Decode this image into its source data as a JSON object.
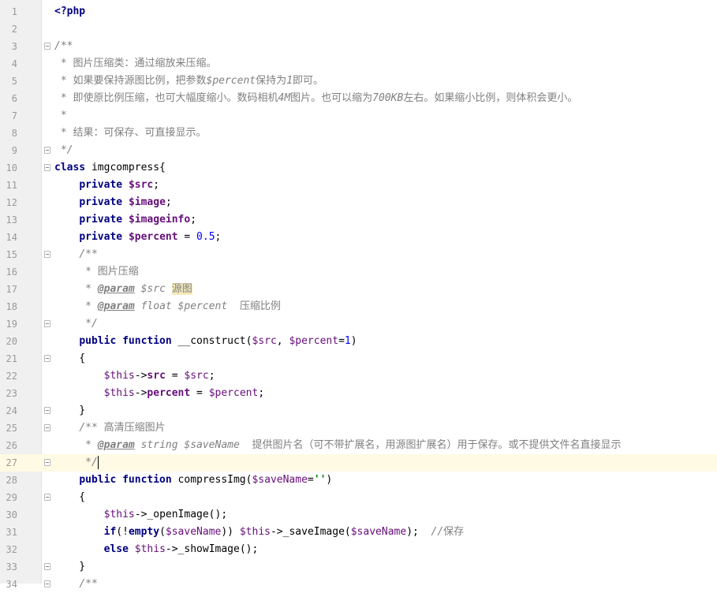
{
  "colors": {
    "keyword": "#000080",
    "variable": "#660e7a",
    "doc_comment": "#808080",
    "string": "#008000",
    "number": "#0000ff",
    "current_line": "#fffae3",
    "highlight": "#f6ebbc"
  },
  "lines": [
    {
      "n": "1",
      "segs": [
        [
          "php-open",
          "<?php"
        ]
      ]
    },
    {
      "n": "2",
      "segs": []
    },
    {
      "n": "3",
      "fold": true,
      "segs": [
        [
          "doc",
          "/**"
        ]
      ]
    },
    {
      "n": "4",
      "segs": [
        [
          "doc",
          " * "
        ],
        [
          "doc-cjk",
          "图片压缩类：通过缩放来压缩。"
        ]
      ]
    },
    {
      "n": "5",
      "segs": [
        [
          "doc",
          " * "
        ],
        [
          "doc-cjk",
          "如果要保持源图比例，把参数"
        ],
        [
          "doc",
          "$percent"
        ],
        [
          "doc-cjk",
          "保持为"
        ],
        [
          "doc",
          "1"
        ],
        [
          "doc-cjk",
          "即可。"
        ]
      ]
    },
    {
      "n": "6",
      "segs": [
        [
          "doc",
          " * "
        ],
        [
          "doc-cjk",
          "即使原比例压缩，也可大幅度缩小。数码相机"
        ],
        [
          "doc",
          "4M"
        ],
        [
          "doc-cjk",
          "图片。也可以缩为"
        ],
        [
          "doc",
          "700KB"
        ],
        [
          "doc-cjk",
          "左右。如果缩小比例，则体积会更小。"
        ]
      ]
    },
    {
      "n": "7",
      "segs": [
        [
          "doc",
          " *"
        ]
      ]
    },
    {
      "n": "8",
      "segs": [
        [
          "doc",
          " * "
        ],
        [
          "doc-cjk",
          "结果：可保存、可直接显示。"
        ]
      ]
    },
    {
      "n": "9",
      "fold": true,
      "segs": [
        [
          "doc",
          " */"
        ]
      ]
    },
    {
      "n": "10",
      "fold": true,
      "segs": [
        [
          "kw",
          "class"
        ],
        [
          "plain",
          " imgcompress{"
        ]
      ]
    },
    {
      "n": "11",
      "segs": [
        [
          "plain",
          "    "
        ],
        [
          "kw",
          "private"
        ],
        [
          "plain",
          " "
        ],
        [
          "prop",
          "$src"
        ],
        [
          "plain",
          ";"
        ]
      ]
    },
    {
      "n": "12",
      "segs": [
        [
          "plain",
          "    "
        ],
        [
          "kw",
          "private"
        ],
        [
          "plain",
          " "
        ],
        [
          "prop",
          "$image"
        ],
        [
          "plain",
          ";"
        ]
      ]
    },
    {
      "n": "13",
      "segs": [
        [
          "plain",
          "    "
        ],
        [
          "kw",
          "private"
        ],
        [
          "plain",
          " "
        ],
        [
          "prop",
          "$imageinfo"
        ],
        [
          "plain",
          ";"
        ]
      ]
    },
    {
      "n": "14",
      "segs": [
        [
          "plain",
          "    "
        ],
        [
          "kw",
          "private"
        ],
        [
          "plain",
          " "
        ],
        [
          "prop",
          "$percent"
        ],
        [
          "plain",
          " = "
        ],
        [
          "num",
          "0.5"
        ],
        [
          "plain",
          ";"
        ]
      ]
    },
    {
      "n": "15",
      "fold": true,
      "segs": [
        [
          "plain",
          "    "
        ],
        [
          "doc",
          "/**"
        ]
      ]
    },
    {
      "n": "16",
      "segs": [
        [
          "plain",
          "    "
        ],
        [
          "doc",
          " * "
        ],
        [
          "doc-cjk",
          "图片压缩"
        ]
      ]
    },
    {
      "n": "17",
      "segs": [
        [
          "plain",
          "    "
        ],
        [
          "doc",
          " * "
        ],
        [
          "tag",
          "@param"
        ],
        [
          "doc",
          " $src "
        ],
        [
          "hl-cjk",
          "源图"
        ]
      ]
    },
    {
      "n": "18",
      "segs": [
        [
          "plain",
          "    "
        ],
        [
          "doc",
          " * "
        ],
        [
          "tag",
          "@param"
        ],
        [
          "doc",
          " float $percent  "
        ],
        [
          "doc-cjk",
          "压缩比例"
        ]
      ]
    },
    {
      "n": "19",
      "fold": true,
      "segs": [
        [
          "plain",
          "    "
        ],
        [
          "doc",
          " */"
        ]
      ]
    },
    {
      "n": "20",
      "segs": [
        [
          "plain",
          "    "
        ],
        [
          "kw",
          "public function"
        ],
        [
          "plain",
          " __construct("
        ],
        [
          "var",
          "$src"
        ],
        [
          "plain",
          ", "
        ],
        [
          "var",
          "$percent"
        ],
        [
          "plain",
          "="
        ],
        [
          "num",
          "1"
        ],
        [
          "plain",
          ")"
        ]
      ]
    },
    {
      "n": "21",
      "fold": true,
      "segs": [
        [
          "plain",
          "    {"
        ]
      ]
    },
    {
      "n": "22",
      "segs": [
        [
          "plain",
          "        "
        ],
        [
          "var",
          "$this"
        ],
        [
          "plain",
          "->"
        ],
        [
          "prop",
          "src"
        ],
        [
          "plain",
          " = "
        ],
        [
          "var",
          "$src"
        ],
        [
          "plain",
          ";"
        ]
      ]
    },
    {
      "n": "23",
      "segs": [
        [
          "plain",
          "        "
        ],
        [
          "var",
          "$this"
        ],
        [
          "plain",
          "->"
        ],
        [
          "prop",
          "percent"
        ],
        [
          "plain",
          " = "
        ],
        [
          "var",
          "$percent"
        ],
        [
          "plain",
          ";"
        ]
      ]
    },
    {
      "n": "24",
      "fold": true,
      "segs": [
        [
          "plain",
          "    }"
        ]
      ]
    },
    {
      "n": "25",
      "fold": true,
      "segs": [
        [
          "plain",
          "    "
        ],
        [
          "doc",
          "/** "
        ],
        [
          "doc-cjk",
          "高清压缩图片"
        ]
      ]
    },
    {
      "n": "26",
      "segs": [
        [
          "plain",
          "    "
        ],
        [
          "doc",
          " * "
        ],
        [
          "tag",
          "@param"
        ],
        [
          "doc",
          " string $saveName  "
        ],
        [
          "doc-cjk",
          "提供图片名（可不带扩展名，用源图扩展名）用于保存。或不提供文件名直接显示"
        ]
      ]
    },
    {
      "n": "27",
      "fold": true,
      "current": true,
      "segs": [
        [
          "plain",
          "    "
        ],
        [
          "doc",
          " */"
        ]
      ]
    },
    {
      "n": "28",
      "segs": [
        [
          "plain",
          "    "
        ],
        [
          "kw",
          "public function"
        ],
        [
          "plain",
          " compressImg("
        ],
        [
          "var",
          "$saveName"
        ],
        [
          "plain",
          "="
        ],
        [
          "str",
          "''"
        ],
        [
          "plain",
          ")"
        ]
      ]
    },
    {
      "n": "29",
      "fold": true,
      "segs": [
        [
          "plain",
          "    {"
        ]
      ]
    },
    {
      "n": "30",
      "segs": [
        [
          "plain",
          "        "
        ],
        [
          "var",
          "$this"
        ],
        [
          "plain",
          "->_openImage();"
        ]
      ]
    },
    {
      "n": "31",
      "segs": [
        [
          "plain",
          "        "
        ],
        [
          "kw",
          "if"
        ],
        [
          "plain",
          "(!"
        ],
        [
          "kw",
          "empty"
        ],
        [
          "plain",
          "("
        ],
        [
          "var",
          "$saveName"
        ],
        [
          "plain",
          ")) "
        ],
        [
          "var",
          "$this"
        ],
        [
          "plain",
          "->_saveImage("
        ],
        [
          "var",
          "$saveName"
        ],
        [
          "plain",
          ");  "
        ],
        [
          "doc",
          "//"
        ],
        [
          "doc-cjk",
          "保存"
        ]
      ]
    },
    {
      "n": "32",
      "segs": [
        [
          "plain",
          "        "
        ],
        [
          "kw",
          "else"
        ],
        [
          "plain",
          " "
        ],
        [
          "var",
          "$this"
        ],
        [
          "plain",
          "->_showImage();"
        ]
      ]
    },
    {
      "n": "33",
      "fold": true,
      "segs": [
        [
          "plain",
          "    }"
        ]
      ]
    },
    {
      "n": "34",
      "fold": true,
      "segs": [
        [
          "plain",
          "    "
        ],
        [
          "doc",
          "/**"
        ]
      ]
    }
  ]
}
